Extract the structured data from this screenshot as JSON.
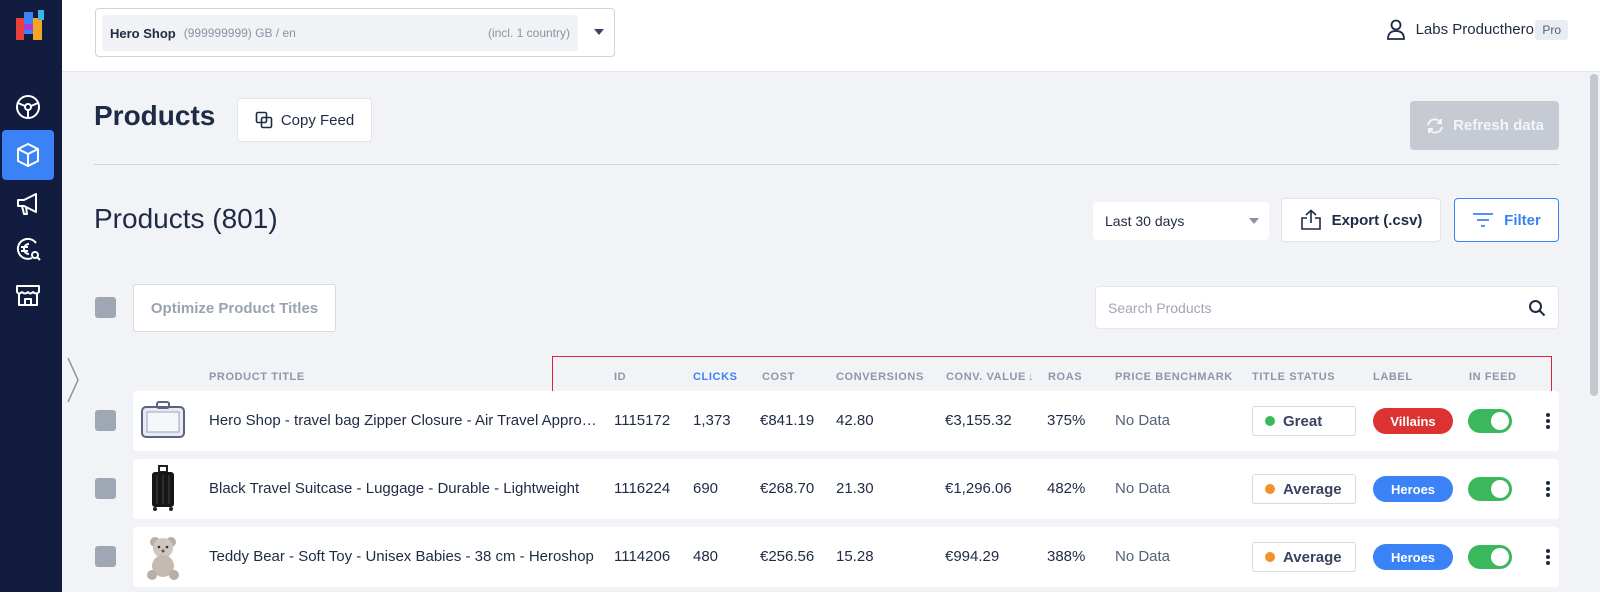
{
  "topbar": {
    "shop_name": "Hero Shop",
    "shop_meta": "(999999999) GB / en",
    "shop_country": "(incl. 1 country)",
    "user_name": "Labs Producthero",
    "plan_badge": "Pro"
  },
  "sidebar": {
    "items": [
      {
        "icon": "steering-wheel-icon",
        "active": false
      },
      {
        "icon": "box-icon",
        "active": true
      },
      {
        "icon": "megaphone-icon",
        "active": false
      },
      {
        "icon": "euro-search-icon",
        "active": false
      },
      {
        "icon": "store-icon",
        "active": false
      }
    ]
  },
  "header": {
    "title": "Products",
    "copy_feed_label": "Copy Feed",
    "refresh_label": "Refresh data"
  },
  "toolbar": {
    "count_title": "Products (801)",
    "date_range": "Last 30 days",
    "export_label": "Export (.csv)",
    "filter_label": "Filter",
    "optimize_label": "Optimize Product Titles",
    "search_placeholder": "Search Products"
  },
  "table": {
    "columns": {
      "title": "PRODUCT TITLE",
      "id": "ID",
      "clicks": "CLICKS",
      "cost": "COST",
      "conversions": "CONVERSIONS",
      "conv_value": "CONV. VALUE",
      "roas": "ROAS",
      "price_benchmark": "PRICE BENCHMARK",
      "title_status": "TITLE STATUS",
      "label": "LABEL",
      "in_feed": "IN FEED"
    },
    "rows": [
      {
        "title": "Hero Shop - travel bag Zipper Closure - Air Travel Approved",
        "id": "1115172",
        "clicks": "1,373",
        "cost": "€841.19",
        "conversions": "42.80",
        "conv_value": "€3,155.32",
        "roas": "375%",
        "price_benchmark": "No Data",
        "title_status": "Great",
        "status_color": "#3cb85c",
        "label": "Villains",
        "label_color": "#dc3232",
        "in_feed": true
      },
      {
        "title": "Black Travel Suitcase - Luggage - Durable - Lightweight",
        "id": "1116224",
        "clicks": "690",
        "cost": "€268.70",
        "conversions": "21.30",
        "conv_value": "€1,296.06",
        "roas": "482%",
        "price_benchmark": "No Data",
        "title_status": "Average",
        "status_color": "#f0932b",
        "label": "Heroes",
        "label_color": "#3b82f6",
        "in_feed": true
      },
      {
        "title": "Teddy Bear - Soft Toy - Unisex Babies - 38 cm - Heroshop",
        "id": "1114206",
        "clicks": "480",
        "cost": "€256.56",
        "conversions": "15.28",
        "conv_value": "€994.29",
        "roas": "388%",
        "price_benchmark": "No Data",
        "title_status": "Average",
        "status_color": "#f0932b",
        "label": "Heroes",
        "label_color": "#3b82f6",
        "in_feed": true
      }
    ]
  },
  "colors": {
    "sidebar_bg": "#111c3f",
    "accent": "#3b82f6",
    "highlight": "#d7263d"
  }
}
